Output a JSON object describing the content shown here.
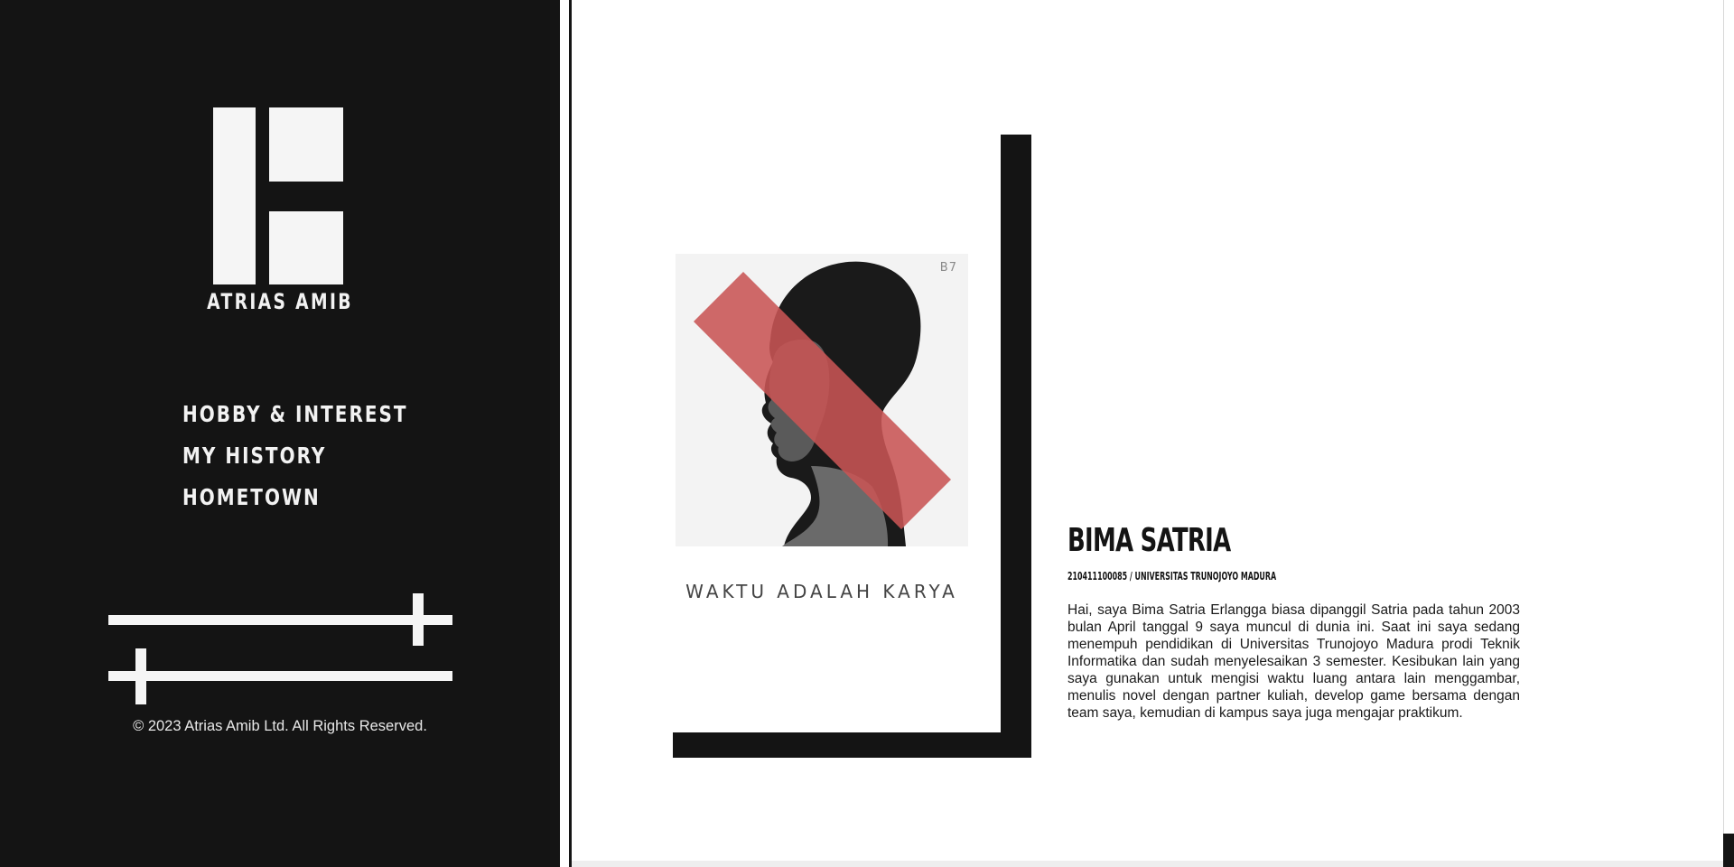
{
  "sidebar": {
    "brand": "ATRIAS AMIB",
    "nav": [
      "HOBBY & INTEREST",
      "MY HISTORY",
      "HOMETOWN"
    ],
    "copyright": "© 2023 Atrias Amib Ltd. All Rights Reserved."
  },
  "sliders": [
    {
      "name": "slider-top",
      "value": 0.9
    },
    {
      "name": "slider-bottom",
      "value": 0.1
    }
  ],
  "card": {
    "photo_code": "B7",
    "tagline": "WAKTU ADALAH KARYA"
  },
  "profile": {
    "name": "BIMA SATRIA",
    "subline": "210411100085 / UNIVERSITAS TRUNOJOYO MADURA",
    "bio": "Hai, saya Bima Satria Erlangga biasa dipanggil Satria pada tahun 2003 bulan April tanggal 9 saya muncul di dunia ini. Saat ini saya sedang menempuh pendidikan di Universitas Trunojoyo Madura prodi Teknik Informatika dan sudah menyelesaikan 3 semester. Kesibukan lain yang saya gunakan untuk mengisi waktu luang antara lain menggambar, menulis novel dengan partner kuliah, develop game bersama dengan team saya, kemudian di kampus saya juga mengajar praktikum."
  },
  "colors": {
    "dark": "#141414",
    "light": "#f5f5f5",
    "accent": "#c85454"
  }
}
